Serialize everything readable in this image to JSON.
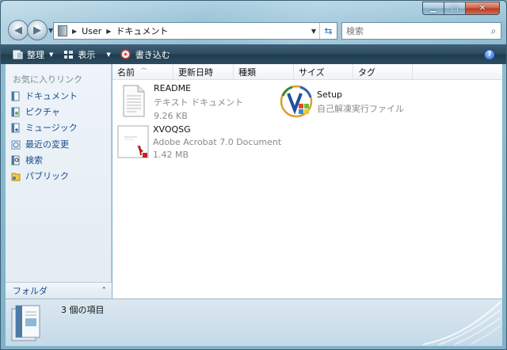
{
  "window": {
    "caption_buttons": [
      "minimize",
      "maximize",
      "close"
    ]
  },
  "address_bar": {
    "path": [
      "User",
      "ドキュメント"
    ]
  },
  "search": {
    "placeholder": "検索"
  },
  "toolbar": {
    "organize": "整理",
    "views": "表示",
    "burn": "書き込む"
  },
  "nav_pane": {
    "title": "お気に入りリンク",
    "items": [
      {
        "label": "ドキュメント",
        "icon": "documents-icon"
      },
      {
        "label": "ピクチャ",
        "icon": "pictures-icon"
      },
      {
        "label": "ミュージック",
        "icon": "music-icon"
      },
      {
        "label": "最近の変更",
        "icon": "recent-icon"
      },
      {
        "label": "検索",
        "icon": "search-folder-icon"
      },
      {
        "label": "パブリック",
        "icon": "public-folder-icon"
      }
    ],
    "folders_label": "フォルダ"
  },
  "columns": [
    "名前",
    "更新日時",
    "種類",
    "サイズ",
    "タグ"
  ],
  "files": [
    {
      "name": "README",
      "type": "テキスト ドキュメント",
      "size": "9.26 KB",
      "icon": "text-document-icon"
    },
    {
      "name": "Setup",
      "type": "自己解凍実行ファイル",
      "icon": "setup-icon"
    },
    {
      "name": "XVOQSG",
      "type": "Adobe Acrobat 7.0 Document",
      "size": "1.42 MB",
      "icon": "pdf-document-icon"
    }
  ],
  "status": {
    "item_count": "3 個の項目"
  },
  "colors": {
    "toolbar": "#2c4a5e",
    "link": "#1a4c8a",
    "secondary_text": "#8a8a8a"
  }
}
